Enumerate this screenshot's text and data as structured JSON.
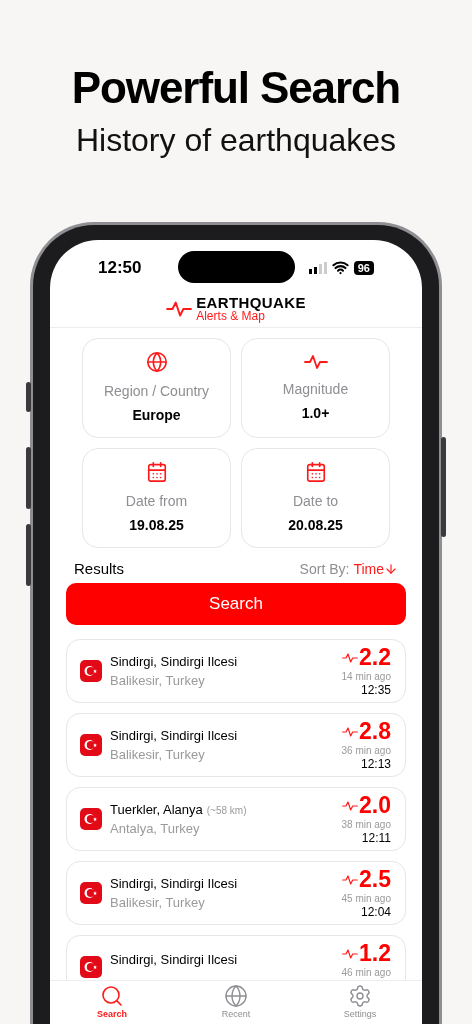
{
  "headline": "Powerful Search",
  "subheadline": "History of earthquakes",
  "status_bar": {
    "time": "12:50",
    "battery": "96"
  },
  "app_logo": {
    "title": "EARTHQUAKE",
    "subtitle": "Alerts & Map"
  },
  "filters": [
    {
      "kind": "region",
      "label": "Region / Country",
      "value": "Europe"
    },
    {
      "kind": "magnitude",
      "label": "Magnitude",
      "value": "1.0+"
    },
    {
      "kind": "date",
      "label": "Date from",
      "value": "19.08.25"
    },
    {
      "kind": "date",
      "label": "Date to",
      "value": "20.08.25"
    }
  ],
  "results_label": "Results",
  "sort": {
    "label": "Sort By:",
    "value": "Time"
  },
  "search_button": "Search",
  "results": [
    {
      "place": "Sindirgi, Sindirgi Ilcesi",
      "region": "Balikesir, Turkey",
      "magnitude": "2.2",
      "ago": "14 min ago",
      "time": "12:35"
    },
    {
      "place": "Sindirgi, Sindirgi Ilcesi",
      "region": "Balikesir, Turkey",
      "magnitude": "2.8",
      "ago": "36 min ago",
      "time": "12:13"
    },
    {
      "place": "Tuerkler, Alanya",
      "distance": "(~58 km)",
      "region": "Antalya, Turkey",
      "magnitude": "2.0",
      "ago": "38 min ago",
      "time": "12:11"
    },
    {
      "place": "Sindirgi, Sindirgi Ilcesi",
      "region": "Balikesir, Turkey",
      "magnitude": "2.5",
      "ago": "45 min ago",
      "time": "12:04"
    },
    {
      "place": "Sindirgi, Sindirgi Ilcesi",
      "magnitude": "1.2",
      "ago": "46 min ago"
    }
  ],
  "tab_bar": [
    {
      "kind": "search",
      "label": "Search",
      "selected": true
    },
    {
      "kind": "globe",
      "label": "Recent",
      "selected": false
    },
    {
      "kind": "settings",
      "label": "Settings",
      "selected": false
    }
  ]
}
